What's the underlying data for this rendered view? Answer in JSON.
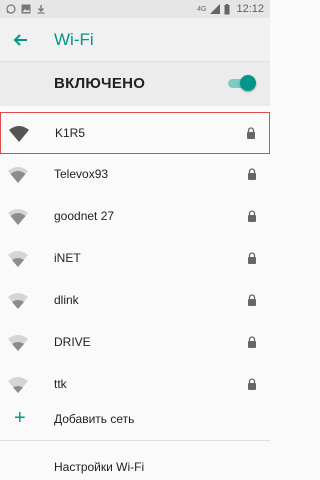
{
  "status": {
    "left_icons": [
      "whatsapp-icon",
      "image-icon",
      "download-icon"
    ],
    "network_type": "4G",
    "time": "12:12"
  },
  "header": {
    "title": "Wi-Fi",
    "back_icon": "arrow-left-icon"
  },
  "master_switch": {
    "label": "ВКЛЮЧЕНО",
    "state": "on"
  },
  "networks": [
    {
      "name": "K1R5",
      "secured": true,
      "selected": true
    },
    {
      "name": "Televox93",
      "secured": true
    },
    {
      "name": "goodnet 27",
      "secured": true
    },
    {
      "name": "iNET",
      "secured": true
    },
    {
      "name": "dlink",
      "secured": true
    },
    {
      "name": "DRIVE",
      "secured": true
    },
    {
      "name": "ttk",
      "secured": true
    }
  ],
  "add_network": {
    "label": "Добавить сеть",
    "icon": "plus-icon"
  },
  "settings": {
    "label": "Настройки Wi-Fi"
  },
  "colors": {
    "accent": "#009688",
    "selected_outline": "#e54a4a"
  }
}
